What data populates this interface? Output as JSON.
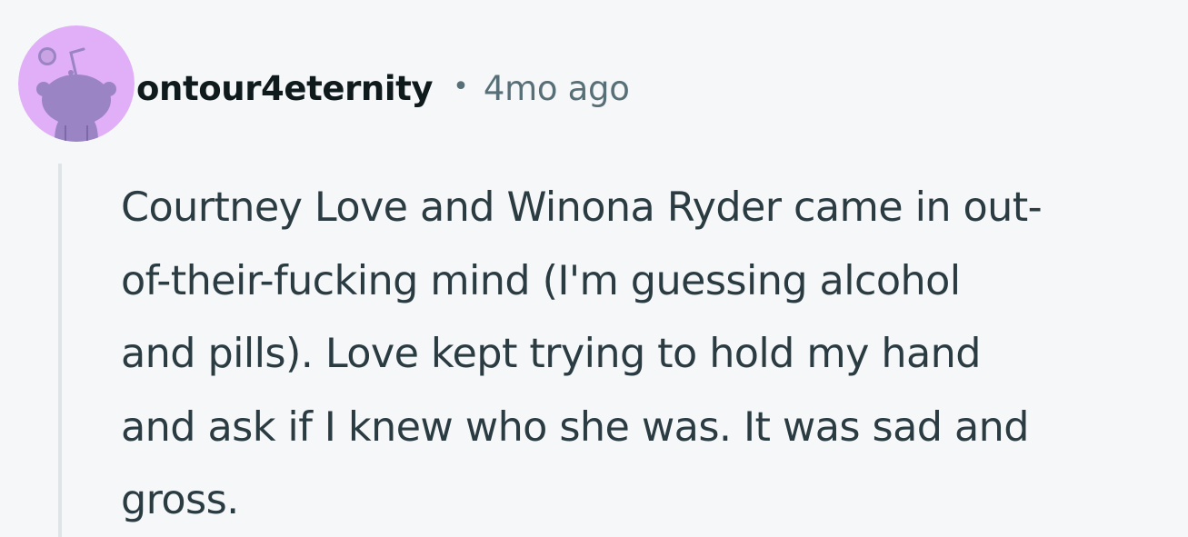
{
  "comment": {
    "author": "ontour4eternity",
    "separator": "•",
    "timestamp": "4mo ago",
    "avatar_icon": "snoo-avatar-icon",
    "body_lines": [
      "Courtney Love and Winona Ryder came in out-",
      "of-their-fucking mind (I'm guessing alcohol",
      "and pills). Love kept trying to hold my hand",
      "and ask if I knew who she was. It was sad and",
      "gross."
    ]
  },
  "colors": {
    "background": "#f6f7f8",
    "avatar_bg": "#e0aff7",
    "avatar_figure": "#9a84c4",
    "username": "#0f1a1c",
    "meta_text": "#576f76",
    "body_text": "#2a3c42",
    "thread_line": "#dfe4e6"
  }
}
